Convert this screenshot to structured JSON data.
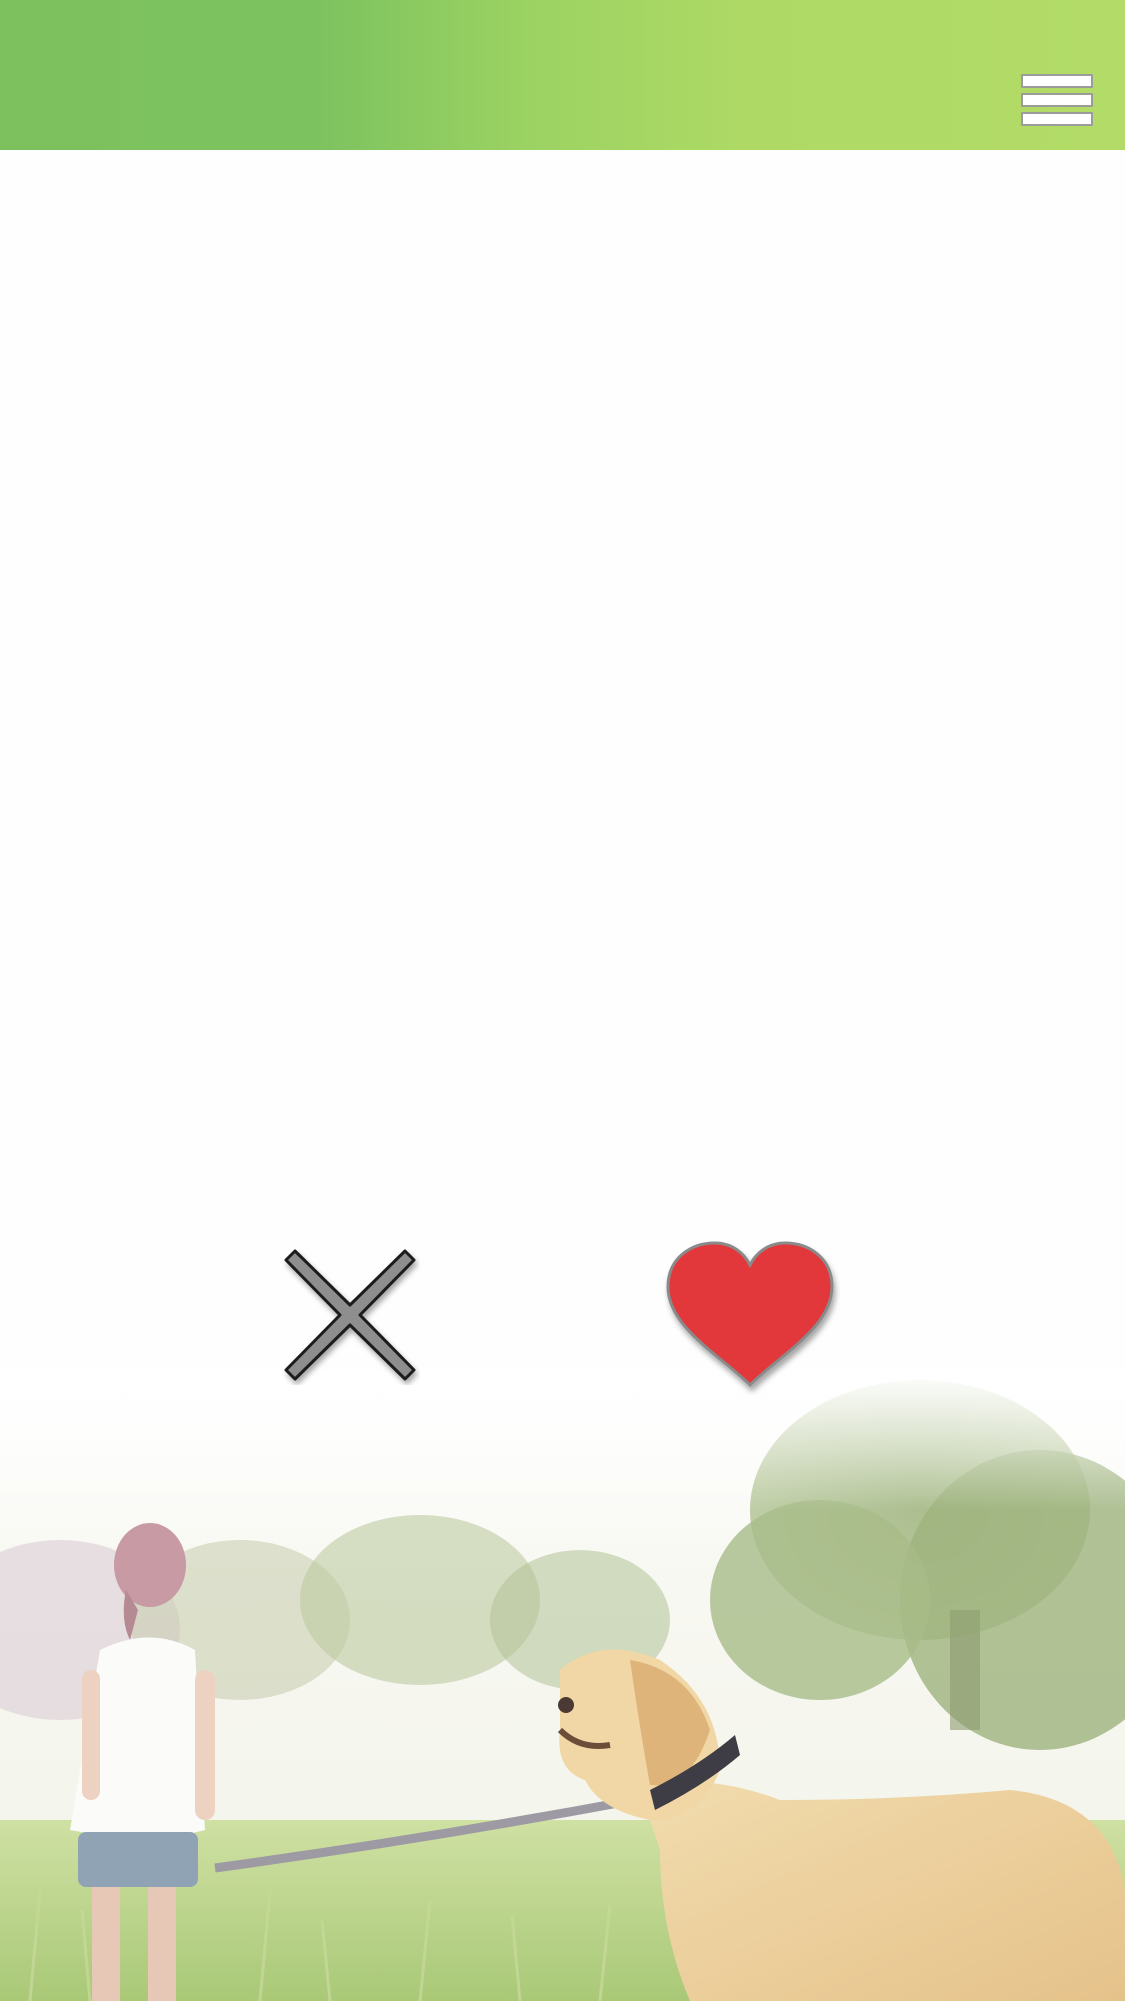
{
  "header": {
    "menu_icon": "hamburger-menu-icon",
    "gradient_start": "#7dc15e",
    "gradient_end": "#b2dc67"
  },
  "actions": {
    "dislike_icon": "close-x-icon",
    "dislike_color": "#8e8e8e",
    "like_icon": "heart-icon",
    "like_color": "#e3383b"
  },
  "background_image": {
    "subject": "girl-walking-golden-retriever-on-leash-in-meadow"
  }
}
